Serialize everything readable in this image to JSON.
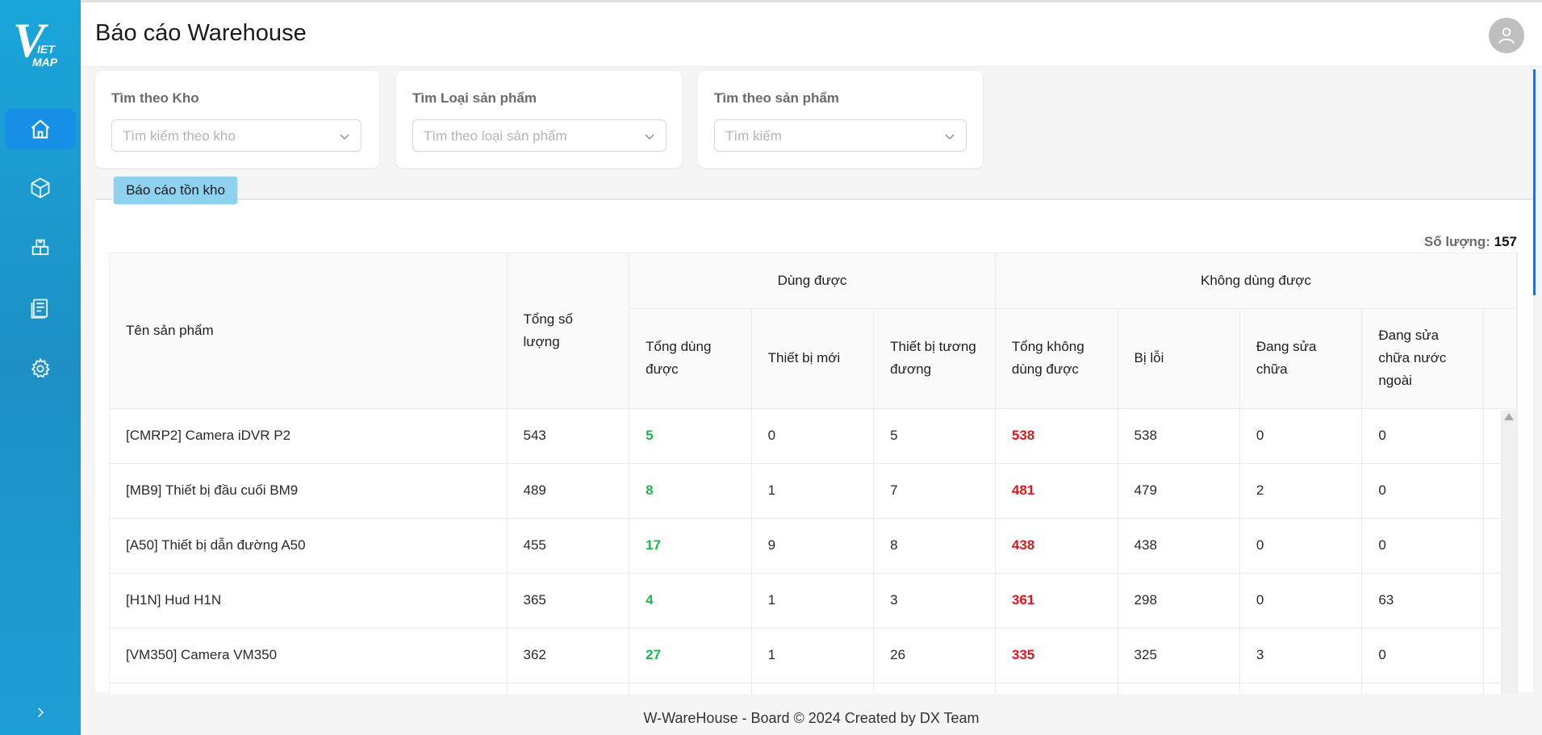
{
  "app": {
    "logo_text": "VIET MAP",
    "title": "Báo cáo Warehouse"
  },
  "sidebar": {
    "items": [
      {
        "name": "home",
        "icon": "home-icon",
        "active": true
      },
      {
        "name": "products",
        "icon": "box-icon",
        "active": false
      },
      {
        "name": "warehouse",
        "icon": "stack-boxes-icon",
        "active": false
      },
      {
        "name": "reports",
        "icon": "document-icon",
        "active": false
      },
      {
        "name": "settings",
        "icon": "gear-icon",
        "active": false
      }
    ],
    "collapse_icon": "chevron-right-icon"
  },
  "filters": [
    {
      "label": "Tìm theo Kho",
      "placeholder": "Tìm kiếm theo kho"
    },
    {
      "label": "Tìm Loại sản phẩm",
      "placeholder": "Tìm theo loại sản phẩm"
    },
    {
      "label": "Tìm theo sản phẩm",
      "placeholder": "Tìm kiếm"
    }
  ],
  "tab": {
    "label": "Báo cáo tồn kho"
  },
  "count": {
    "label": "Số lượng:",
    "value": "157"
  },
  "table": {
    "headers": {
      "name": "Tên sản phẩm",
      "total": "Tổng số lượng",
      "usable_group": "Dùng được",
      "unusable_group": "Không dùng được",
      "usable_total": "Tổng dùng được",
      "new_devices": "Thiết bị mới",
      "equivalent": "Thiết bị tương đương",
      "unusable_total": "Tổng không dùng được",
      "faulty": "Bị lỗi",
      "repairing": "Đang sửa chữa",
      "repairing_abroad": "Đang sửa chữa nước ngoài"
    },
    "rows": [
      [
        "[CMRP2] Camera iDVR P2",
        "543",
        "5",
        "0",
        "5",
        "538",
        "538",
        "0",
        "0"
      ],
      [
        "[MB9] Thiết bị đầu cuối BM9",
        "489",
        "8",
        "1",
        "7",
        "481",
        "479",
        "2",
        "0"
      ],
      [
        "[A50] Thiết bị dẫn đường A50",
        "455",
        "17",
        "9",
        "8",
        "438",
        "438",
        "0",
        "0"
      ],
      [
        "[H1N] Hud H1N",
        "365",
        "4",
        "1",
        "3",
        "361",
        "298",
        "0",
        "63"
      ],
      [
        "[VM350] Camera VM350",
        "362",
        "27",
        "1",
        "26",
        "335",
        "325",
        "3",
        "0"
      ]
    ]
  },
  "footer": {
    "text": "W-WareHouse - Board © 2024 Created by DX Team"
  },
  "colors": {
    "sidebar": "#1d9bd4",
    "active_nav": "#178fe6",
    "tab": "#8fd2ef",
    "usable": "#1db94a",
    "unusable": "#e6141a"
  }
}
